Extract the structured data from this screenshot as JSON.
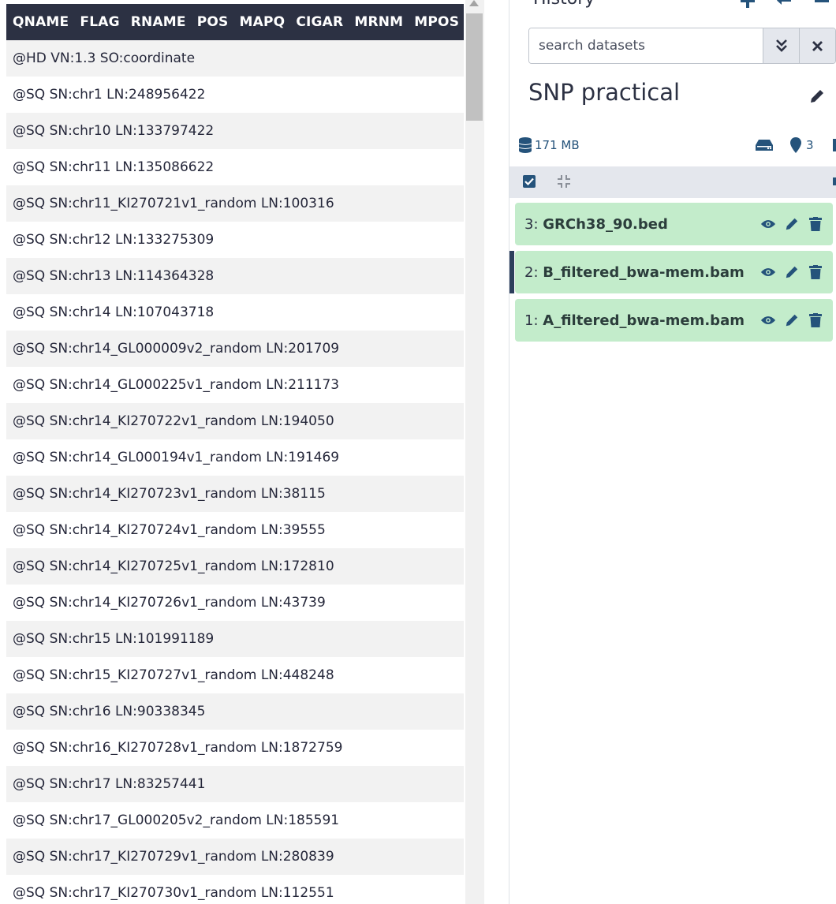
{
  "viewer": {
    "columns": [
      "QNAME",
      "FLAG",
      "RNAME",
      "POS",
      "MAPQ",
      "CIGAR",
      "MRNM",
      "MPOS"
    ],
    "rows": [
      "@HD VN:1.3 SO:coordinate",
      "@SQ SN:chr1 LN:248956422",
      "@SQ SN:chr10 LN:133797422",
      "@SQ SN:chr11 LN:135086622",
      "@SQ SN:chr11_KI270721v1_random LN:100316",
      "@SQ SN:chr12 LN:133275309",
      "@SQ SN:chr13 LN:114364328",
      "@SQ SN:chr14 LN:107043718",
      "@SQ SN:chr14_GL000009v2_random LN:201709",
      "@SQ SN:chr14_GL000225v1_random LN:211173",
      "@SQ SN:chr14_KI270722v1_random LN:194050",
      "@SQ SN:chr14_GL000194v1_random LN:191469",
      "@SQ SN:chr14_KI270723v1_random LN:38115",
      "@SQ SN:chr14_KI270724v1_random LN:39555",
      "@SQ SN:chr14_KI270725v1_random LN:172810",
      "@SQ SN:chr14_KI270726v1_random LN:43739",
      "@SQ SN:chr15 LN:101991189",
      "@SQ SN:chr15_KI270727v1_random LN:448248",
      "@SQ SN:chr16 LN:90338345",
      "@SQ SN:chr16_KI270728v1_random LN:1872759",
      "@SQ SN:chr17 LN:83257441",
      "@SQ SN:chr17_GL000205v2_random LN:185591",
      "@SQ SN:chr17_KI270729v1_random LN:280839",
      "@SQ SN:chr17_KI270730v1_random LN:112551"
    ]
  },
  "history": {
    "heading": "History",
    "search_placeholder": "search datasets",
    "name": "SNP practical",
    "size": "171 MB",
    "pinned_count": "3",
    "datasets": [
      {
        "hid": "3:",
        "name": "GRCh38_90.bed",
        "active": false
      },
      {
        "hid": "2:",
        "name": "B_filtered_bwa-mem.bam",
        "active": true
      },
      {
        "hid": "1:",
        "name": "A_filtered_bwa-mem.bam",
        "active": false
      }
    ]
  },
  "colors": {
    "header_bg": "#2c3143",
    "dataset_ok": "#c3eccb",
    "accent": "#25537b"
  },
  "icons": [
    "plus-icon",
    "switch-icon",
    "menu-icon",
    "advanced-search-icon",
    "clear-icon",
    "pencil-icon",
    "database-icon",
    "hdd-icon",
    "map-marker-icon",
    "checkbox-icon",
    "compress-icon",
    "eye-icon",
    "trash-icon"
  ]
}
